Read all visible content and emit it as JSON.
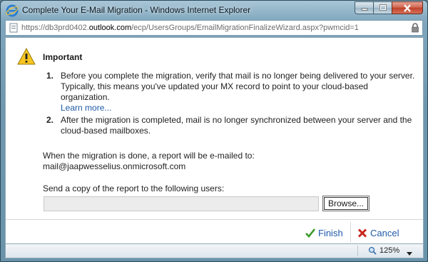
{
  "window": {
    "title": "Complete Your E-Mail Migration - Windows Internet Explorer",
    "url_prefix": "https://db3prd0402.",
    "url_domain": "outlook.com",
    "url_path": "/ecp/UsersGroups/EmailMigrationFinalizeWizard.aspx?pwmcid=1"
  },
  "dialog": {
    "heading": "Important",
    "items": [
      {
        "number": "1.",
        "line1": "Before you complete the migration, verify that mail is no longer being delivered to your server.",
        "line2": "Typically, this means you've updated your MX record to point to your cloud-based organization.",
        "link": "Learn more..."
      },
      {
        "number": "2.",
        "line1": "After the migration is completed, mail is no longer synchronized between your server and the",
        "line2": "cloud-based mailboxes."
      }
    ],
    "report_label": "When the migration is done, a report will be e-mailed to:",
    "report_email": "mail@jaapwesselius.onmicrosoft.com",
    "copy_label": "Send a copy of the report to the following users:",
    "copy_value": "",
    "browse_label": "Browse..."
  },
  "footer": {
    "finish_label": "Finish",
    "cancel_label": "Cancel"
  },
  "status": {
    "zoom": "125%"
  },
  "colors": {
    "link": "#1e5aa8",
    "finish_check": "#3a9a2a",
    "cancel_x": "#c8281e"
  }
}
